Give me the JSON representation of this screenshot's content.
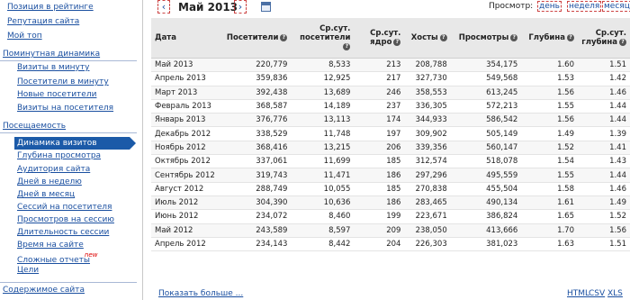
{
  "sidebar": {
    "top_items": [
      "Позиция в рейтинге",
      "Репутация сайта",
      "Мой топ"
    ],
    "sections": [
      {
        "title": "Поминутная динамика",
        "items": [
          "Визиты в минуту",
          "Посетители в минуту",
          "Новые посетители",
          "Визиты на посетителя"
        ]
      },
      {
        "title": "Посещаемость",
        "items": [
          "Динамика визитов",
          "Глубина просмотра",
          "Аудитория сайта",
          "Дней в неделю",
          "Дней в месяц",
          "Сессий на посетителя",
          "Просмотров на сессию",
          "Длительность сессии",
          "Время на сайте",
          "Сложные отчеты",
          "Цели"
        ]
      },
      {
        "title": "Содержимое сайта",
        "items": []
      }
    ],
    "active_item": "Динамика визитов",
    "new_badge": "new"
  },
  "header": {
    "prev": "‹",
    "next": "›",
    "month": "Май 2013",
    "view_label": "Просмотр:",
    "view_options": [
      "день",
      "неделя",
      "месяц"
    ]
  },
  "table": {
    "columns": [
      "Дата",
      "Посетители",
      "Ср.сут. посетители",
      "Ср.сут. ядро",
      "Хосты",
      "Просмотры",
      "Глубина",
      "Ср.сут. глубина"
    ],
    "rows": [
      [
        "Май 2013",
        "220,779",
        "8,533",
        "213",
        "208,788",
        "354,175",
        "1.60",
        "1.51"
      ],
      [
        "Апрель 2013",
        "359,836",
        "12,925",
        "217",
        "327,730",
        "549,568",
        "1.53",
        "1.42"
      ],
      [
        "Март 2013",
        "392,438",
        "13,689",
        "246",
        "358,553",
        "613,245",
        "1.56",
        "1.46"
      ],
      [
        "Февраль 2013",
        "368,587",
        "14,189",
        "237",
        "336,305",
        "572,213",
        "1.55",
        "1.44"
      ],
      [
        "Январь 2013",
        "376,776",
        "13,113",
        "174",
        "344,933",
        "586,542",
        "1.56",
        "1.44"
      ],
      [
        "Декабрь 2012",
        "338,529",
        "11,748",
        "197",
        "309,902",
        "505,149",
        "1.49",
        "1.39"
      ],
      [
        "Ноябрь 2012",
        "368,416",
        "13,215",
        "206",
        "339,356",
        "560,147",
        "1.52",
        "1.41"
      ],
      [
        "Октябрь 2012",
        "337,061",
        "11,699",
        "185",
        "312,574",
        "518,078",
        "1.54",
        "1.43"
      ],
      [
        "Сентябрь 2012",
        "319,743",
        "11,471",
        "186",
        "297,296",
        "495,559",
        "1.55",
        "1.44"
      ],
      [
        "Август 2012",
        "288,749",
        "10,055",
        "185",
        "270,838",
        "455,504",
        "1.58",
        "1.46"
      ],
      [
        "Июль 2012",
        "304,390",
        "10,636",
        "186",
        "283,465",
        "490,134",
        "1.61",
        "1.49"
      ],
      [
        "Июнь 2012",
        "234,072",
        "8,460",
        "199",
        "223,671",
        "386,824",
        "1.65",
        "1.52"
      ],
      [
        "Май 2012",
        "243,589",
        "8,597",
        "209",
        "238,050",
        "413,666",
        "1.70",
        "1.56"
      ],
      [
        "Апрель 2012",
        "234,143",
        "8,442",
        "204",
        "226,303",
        "381,023",
        "1.63",
        "1.51"
      ]
    ]
  },
  "footer": {
    "show_more": "Показать больше ...",
    "exports": [
      "HTML",
      "CSV",
      "XLS"
    ]
  }
}
